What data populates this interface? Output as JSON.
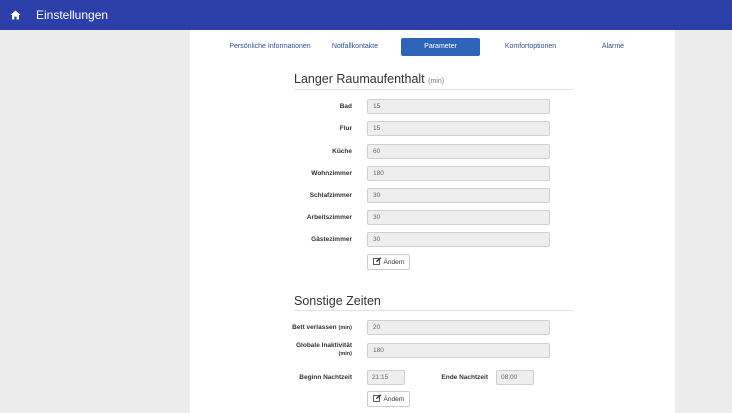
{
  "header": {
    "title": "Einstellungen",
    "icon": "home-icon",
    "color": "#2c3ea8"
  },
  "tabs": [
    {
      "label": "Persönliche Informationen",
      "active": false
    },
    {
      "label": "Notfallkontakte",
      "active": false
    },
    {
      "label": "Parameter",
      "active": true
    },
    {
      "label": "Komfortoptionen",
      "active": false
    },
    {
      "label": "Alarme",
      "active": false
    }
  ],
  "long_stay": {
    "title": "Langer Raumaufenthalt",
    "unit": "(min)",
    "rows": [
      {
        "label": "Bad",
        "value": "15"
      },
      {
        "label": "Flur",
        "value": "15"
      },
      {
        "label": "Küche",
        "value": "60"
      },
      {
        "label": "Wohnzimmer",
        "value": "180"
      },
      {
        "label": "Schlafzimmer",
        "value": "30"
      },
      {
        "label": "Arbeitszimmer",
        "value": "30"
      },
      {
        "label": "Gästezimmer",
        "value": "30"
      }
    ],
    "edit_label": "Ändern"
  },
  "other_times": {
    "title": "Sonstige Zeiten",
    "bed_leave": {
      "label": "Bett verlassen",
      "unit": "(min)",
      "value": "20"
    },
    "global_inactivity": {
      "label": "Globale Inaktivität",
      "unit": "(min)",
      "value": "180"
    },
    "night_start": {
      "label": "Beginn Nachtzeit",
      "value": "21:15"
    },
    "night_end": {
      "label": "Ende Nachtzeit",
      "value": "08:00"
    },
    "edit_label": "Ändern"
  },
  "colors": {
    "accent": "#2f64b8",
    "link": "#2e4f8f"
  }
}
